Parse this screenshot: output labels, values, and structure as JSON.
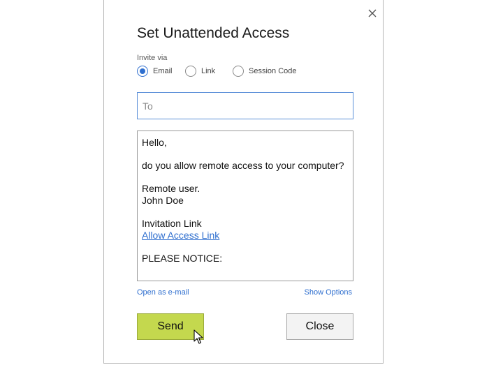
{
  "dialog": {
    "title": "Set Unattended Access",
    "invite_via_label": "Invite via",
    "invite_options": [
      {
        "label": "Email",
        "selected": true
      },
      {
        "label": "Link",
        "selected": false
      },
      {
        "label": "Session Code",
        "selected": false
      }
    ],
    "to_field": {
      "value": "",
      "placeholder": "To"
    },
    "message": {
      "greeting": "Hello,",
      "line1": "do you allow remote access to your computer?",
      "sign1": "Remote user.",
      "sign2": "John Doe",
      "invitation_label": "Invitation Link",
      "invitation_link": "Allow Access Link",
      "notice": "PLEASE NOTICE:"
    },
    "open_email_link": "Open as e-mail",
    "show_options_link": "Show Options",
    "send_label": "Send",
    "close_label": "Close"
  },
  "colors": {
    "accent": "#2f6fcf",
    "send_button": "#c4d84e",
    "close_button": "#f3f3f3"
  },
  "icons": {
    "close": "close-icon",
    "cursor": "mouse-pointer-icon"
  }
}
